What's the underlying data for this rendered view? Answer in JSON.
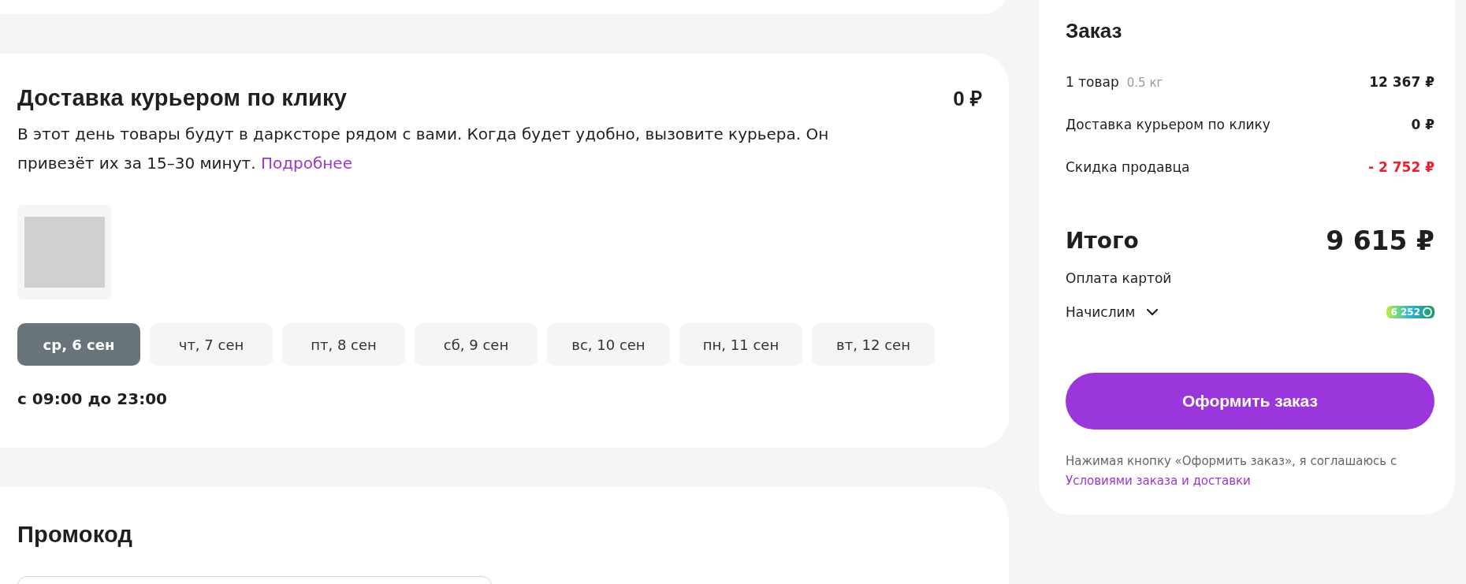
{
  "delivery": {
    "title": "Доставка курьером по клику",
    "price": "0 ₽",
    "description": "В этот день товары будут в дарксторе рядом с вами. Когда будет удобно, вызовите курьера. Он привезёт их за 15–30 минут.",
    "link": "Подробнее",
    "dates": [
      {
        "label": "ср, 6 сен",
        "selected": true
      },
      {
        "label": "чт, 7 сен",
        "selected": false
      },
      {
        "label": "пт, 8 сен",
        "selected": false
      },
      {
        "label": "сб, 9 сен",
        "selected": false
      },
      {
        "label": "вс, 10 сен",
        "selected": false
      },
      {
        "label": "пн, 11 сен",
        "selected": false
      },
      {
        "label": "вт, 12 сен",
        "selected": false
      }
    ],
    "time": "с 09:00 до 23:00"
  },
  "promo": {
    "title": "Промокод"
  },
  "order": {
    "title": "Заказ",
    "lines": [
      {
        "label": "1 товар",
        "note": "0.5 кг",
        "value": "12 367 ₽",
        "kind": "normal"
      },
      {
        "label": "Доставка курьером по клику",
        "value": "0 ₽",
        "kind": "normal"
      },
      {
        "label": "Скидка продавца",
        "value": "- 2 752 ₽",
        "kind": "discount"
      }
    ],
    "total_label": "Итого",
    "total": "9 615 ₽",
    "payment": "Оплата картой",
    "bonus_label": "Начислим",
    "bonus": "6 252",
    "button": "Оформить заказ",
    "agreement": "Нажимая кнопку «Оформить заказ», я соглашаюсь с",
    "agreement_link": "Условиями заказа и доставки"
  }
}
